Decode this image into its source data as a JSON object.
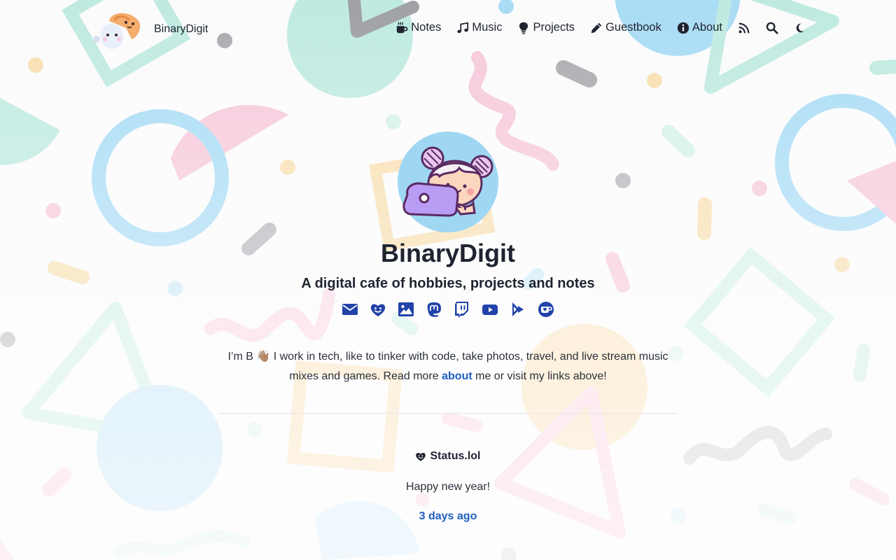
{
  "site": {
    "brand_name": "BinaryDigit",
    "title": "BinaryDigit",
    "tagline": "A digital cafe of hobbies, projects and notes"
  },
  "nav": {
    "items": [
      {
        "label": "Notes",
        "icon": "coffee-mug-icon"
      },
      {
        "label": "Music",
        "icon": "music-note-icon"
      },
      {
        "label": "Projects",
        "icon": "lightbulb-icon"
      },
      {
        "label": "Guestbook",
        "icon": "pencil-icon"
      },
      {
        "label": "About",
        "icon": "info-circle-icon"
      }
    ],
    "utility_icons": [
      "rss-icon",
      "search-icon",
      "moon-icon"
    ]
  },
  "socials": [
    "email-icon",
    "smiley-heart-icon",
    "photo-icon",
    "mastodon-icon",
    "twitch-icon",
    "youtube-icon",
    "play-arrows-icon",
    "ko-fi-icon"
  ],
  "intro": {
    "before": "I’m B 👋🏽 I work in tech, like to tinker with code, take photos, travel, and live stream music mixes and games. Read more ",
    "link": "about",
    "after": " me or visit my links above!"
  },
  "status": {
    "heading": "Status.lol",
    "message": "Happy new year!",
    "time": "3 days ago"
  },
  "colors": {
    "text": "#1f2430",
    "link": "#1f5fbf",
    "social_icon": "#2142a8",
    "mint": "#bfeae0",
    "pink": "#f6c9db",
    "sky": "#a9dcf5",
    "peach": "#f8dfb0",
    "gray": "#b4b6ba"
  }
}
